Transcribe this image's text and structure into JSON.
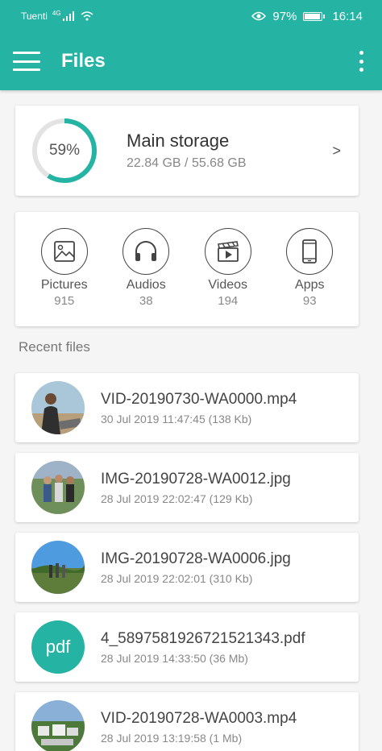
{
  "status_bar": {
    "carrier": "Tuenti",
    "network": "4G",
    "battery": "97%",
    "time": "16:14"
  },
  "app_bar": {
    "title": "Files"
  },
  "storage": {
    "percent_label": "59%",
    "used_fraction": 0.59,
    "title": "Main storage",
    "usage": "22.84 GB / 55.68 GB",
    "chevron": ">"
  },
  "categories": [
    {
      "label": "Pictures",
      "count": "915",
      "icon": "image-icon"
    },
    {
      "label": "Audios",
      "count": "38",
      "icon": "headphones-icon"
    },
    {
      "label": "Videos",
      "count": "194",
      "icon": "clapperboard-icon"
    },
    {
      "label": "Apps",
      "count": "93",
      "icon": "phone-icon"
    }
  ],
  "recent": {
    "title": "Recent files",
    "files": [
      {
        "name": "VID-20190730-WA0000.mp4",
        "meta": "30 Jul 2019 11:47:45 (138 Kb)",
        "thumb": "photo"
      },
      {
        "name": "IMG-20190728-WA0012.jpg",
        "meta": "28 Jul 2019 22:02:47 (129 Kb)",
        "thumb": "photo"
      },
      {
        "name": "IMG-20190728-WA0006.jpg",
        "meta": "28 Jul 2019 22:02:01 (310 Kb)",
        "thumb": "photo"
      },
      {
        "name": "4_5897581926721521343.pdf",
        "meta": "28 Jul 2019 14:33:50 (36 Mb)",
        "thumb": "pdf",
        "thumb_label": "pdf"
      },
      {
        "name": "VID-20190728-WA0003.mp4",
        "meta": "28 Jul 2019 13:19:58 (1 Mb)",
        "thumb": "photo"
      }
    ]
  },
  "colors": {
    "accent": "#25b3a3"
  }
}
